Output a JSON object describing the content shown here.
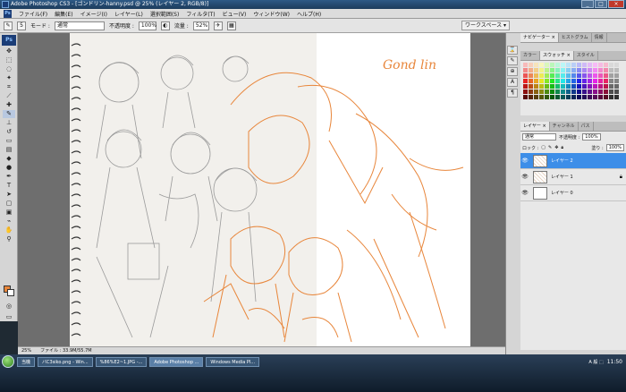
{
  "window": {
    "title": "Adobe Photoshop CS3 - [ゴンドリン-hanny.psd @ 25% (レイヤー 2, RGB/8)]",
    "buttons": [
      "_",
      "□",
      "×"
    ]
  },
  "menu": [
    "ファイル(F)",
    "編集(E)",
    "イメージ(I)",
    "レイヤー(L)",
    "選択範囲(S)",
    "フィルタ(T)",
    "ビュー(V)",
    "ウィンドウ(W)",
    "ヘルプ(H)"
  ],
  "options": {
    "brush_size": "5",
    "mode_label": "モード :",
    "mode_value": "通常",
    "opacity_label": "不透明度 :",
    "opacity_value": "100%",
    "flow_label": "流量 :",
    "flow_value": "52%",
    "workspace": "ワークスペース ▾"
  },
  "canvas": {
    "artist_text": "Gond lin"
  },
  "status": {
    "zoom": "25%",
    "file": "ファイル : 33.9M/55.7M"
  },
  "panels": {
    "top_tabs": [
      "ナビゲーター ×",
      "ヒストグラム",
      "情報"
    ],
    "swatch_tabs": [
      "カラー",
      "スウォッチ ×",
      "スタイル"
    ],
    "layer_tabs": [
      "レイヤー ×",
      "チャンネル",
      "パス"
    ],
    "blend": "通常",
    "opacity_label": "不透明度 :",
    "opacity": "100%",
    "lock_label": "ロック :",
    "fill_label": "塗り :",
    "fill": "100%",
    "layers": [
      {
        "name": "レイヤー 2",
        "selected": true,
        "thumb": "sketch",
        "locked": false
      },
      {
        "name": "レイヤー 1",
        "selected": false,
        "thumb": "sketch",
        "locked": true
      },
      {
        "name": "レイヤー 0",
        "selected": false,
        "thumb": "white",
        "locked": false
      }
    ]
  },
  "taskbar": {
    "tasks": [
      "当機",
      "バC3siko.png - Win...",
      "%86%E2~1.JPG -...",
      "Adobe Photoshop ...",
      "Windows Media Pl..."
    ],
    "active_index": 3,
    "tray_lang": "A 般 ⬚",
    "clock": "11:50"
  },
  "colors": {
    "foreground": "#e8863b",
    "background": "#ffffff",
    "sketch_orange": "#e8863b",
    "selected_layer": "#3d8ee8"
  }
}
